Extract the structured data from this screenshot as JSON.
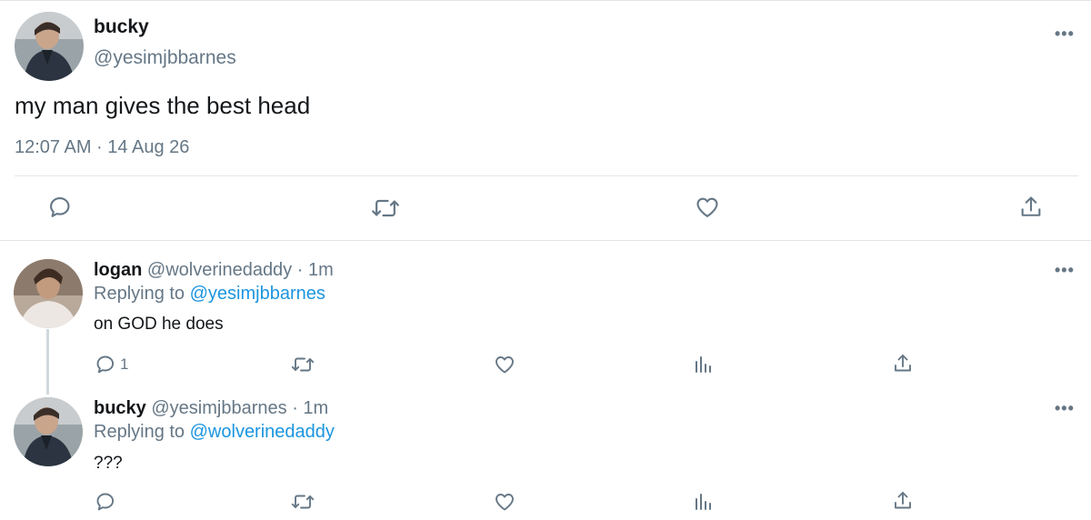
{
  "main_tweet": {
    "display_name": "bucky",
    "handle": "@yesimjbbarnes",
    "text": "my man gives the best head",
    "timestamp": "12:07 AM · 14 Aug 26",
    "more_icon": "more-horizontal-icon",
    "actions": [
      "reply-icon",
      "retweet-icon",
      "like-icon",
      "share-icon"
    ]
  },
  "replies": [
    {
      "display_name": "logan",
      "handle": "@wolverinedaddy",
      "separator": "·",
      "age": "1m",
      "replying_prefix": "Replying to",
      "replying_to": "@yesimjbbarnes",
      "text": "on GOD he does",
      "reply_count": "1",
      "actions": [
        "reply-icon",
        "retweet-icon",
        "like-icon",
        "analytics-icon",
        "share-icon"
      ]
    },
    {
      "display_name": "bucky",
      "handle": "@yesimjbbarnes",
      "separator": "·",
      "age": "1m",
      "replying_prefix": "Replying to",
      "replying_to": "@wolverinedaddy",
      "text": "???",
      "reply_count": "",
      "actions": [
        "reply-icon",
        "retweet-icon",
        "like-icon",
        "analytics-icon",
        "share-icon"
      ]
    }
  ],
  "colors": {
    "text": "#14171a",
    "secondary": "#657786",
    "link": "#1b95e0",
    "divider": "#e1e5e8",
    "thread_line": "#cfd9de"
  }
}
